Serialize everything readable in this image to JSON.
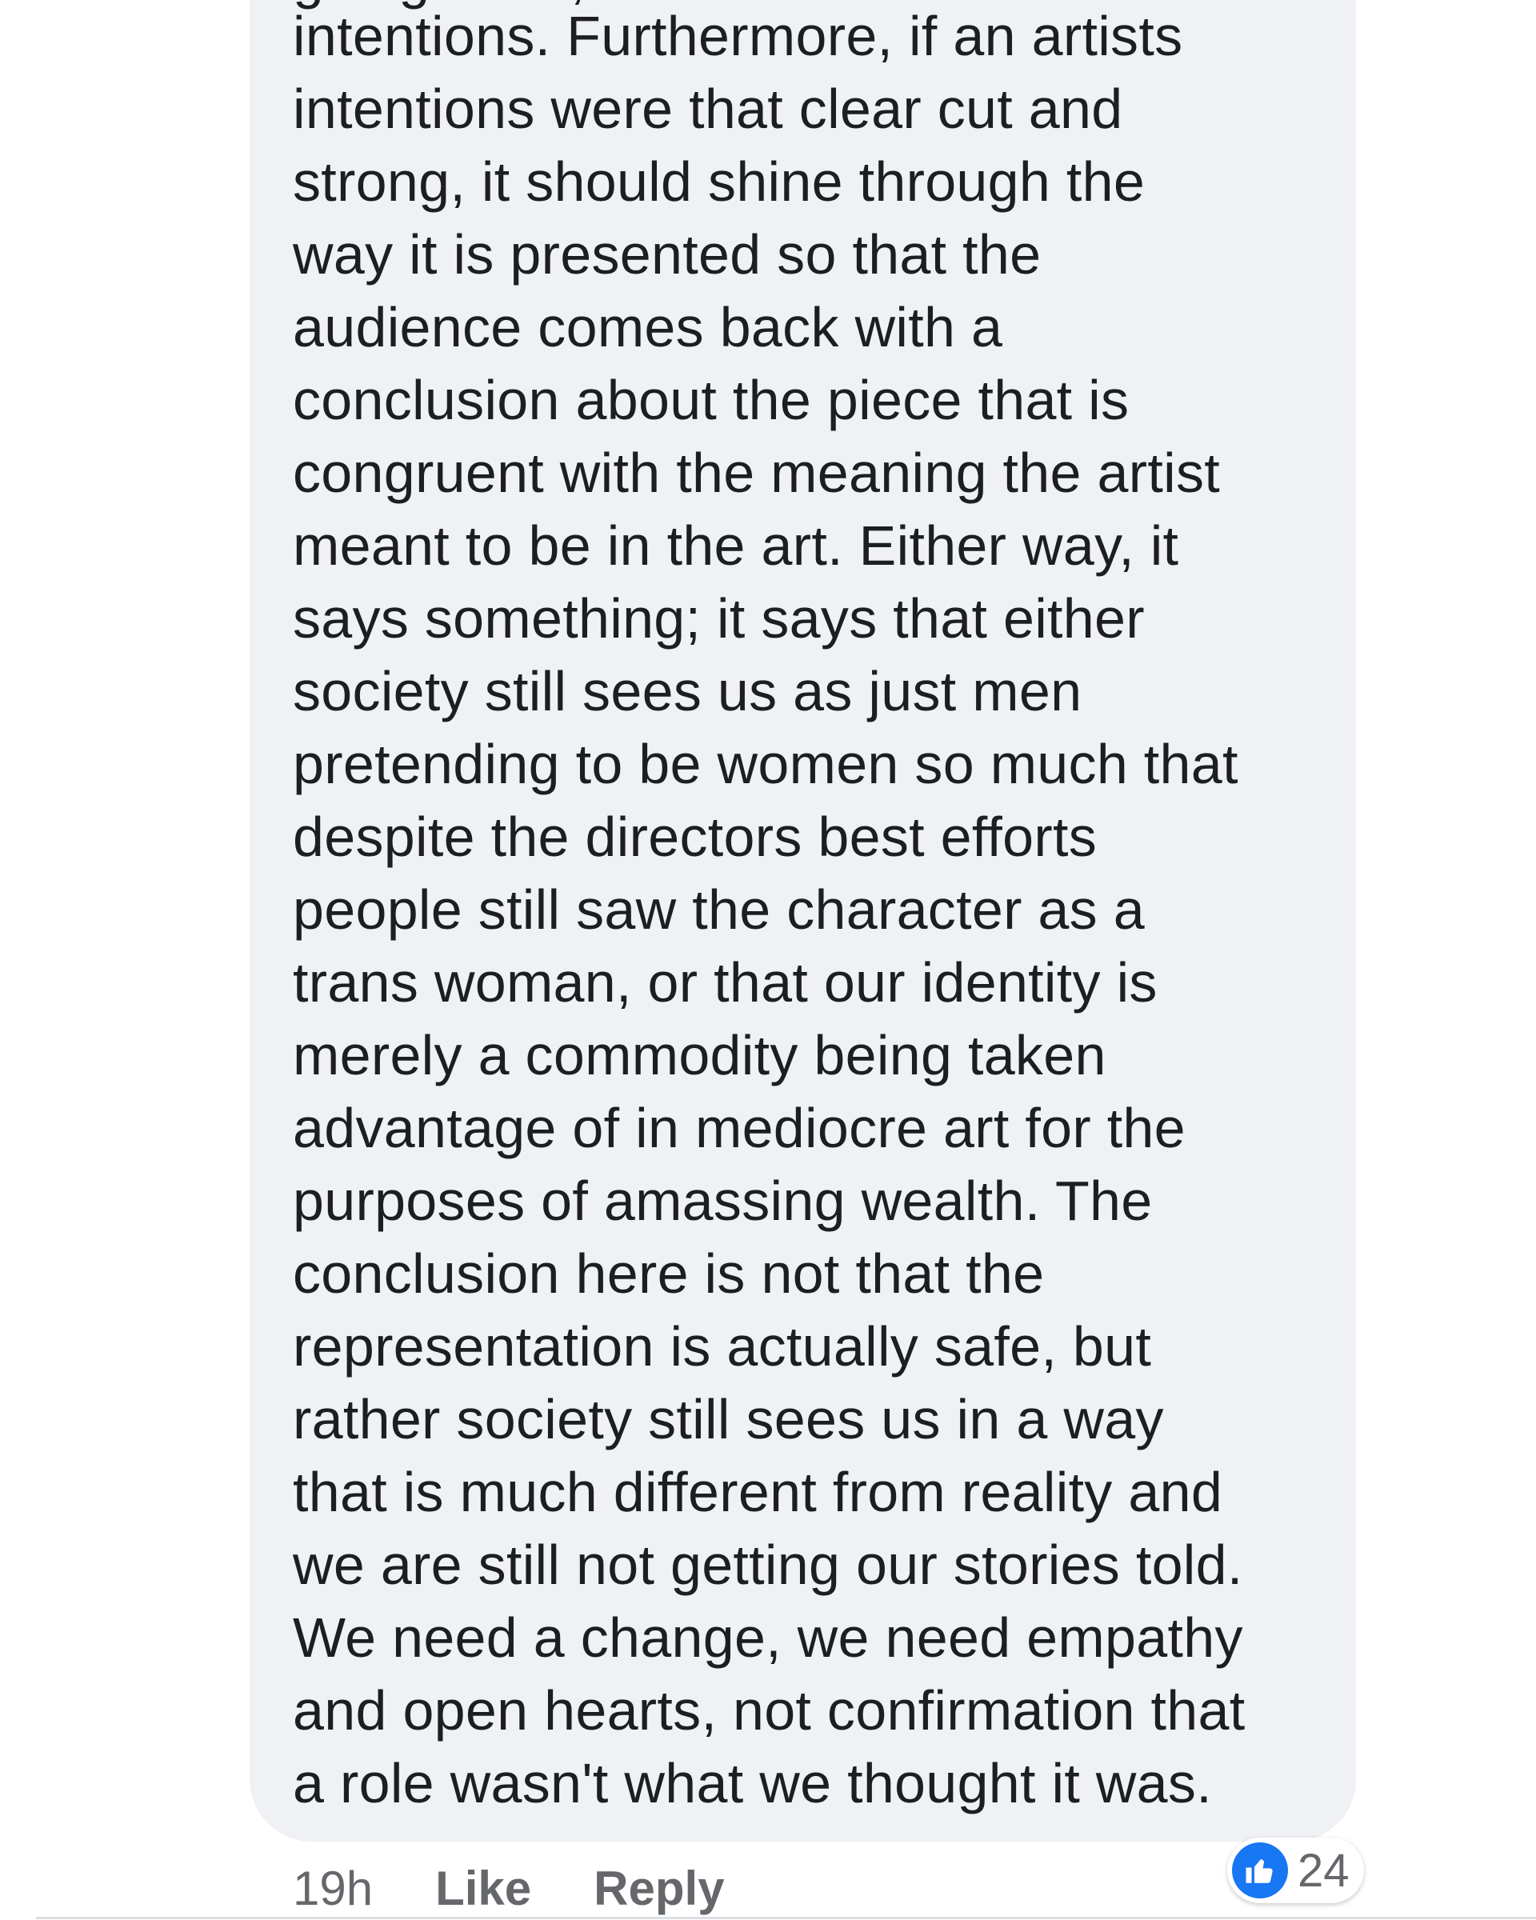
{
  "comment": {
    "cut_line": "going to be, and the director's",
    "lines": [
      "intentions. Furthermore, if an artists",
      "intentions were that clear cut and",
      "strong, it should shine through the",
      "way it is presented so that the",
      "audience comes back with a",
      "conclusion about the piece that is",
      "congruent with the meaning the artist",
      "meant to be in the art. Either way, it",
      "says something; it says that either",
      "society still sees us as just men",
      "pretending to be women so much that",
      "despite the directors best efforts",
      "people still saw the character as a",
      "trans woman, or that our identity is",
      "merely a commodity being taken",
      "advantage of in mediocre art for the",
      "purposes of amassing wealth. The",
      "conclusion here is not that the",
      "representation is actually safe, but",
      "rather society still sees us in a way",
      "that is much different from reality and",
      "we are still not getting our stories told.",
      "We need a change, we need empathy",
      "and open hearts, not confirmation that",
      "a role wasn't what we thought it was."
    ]
  },
  "actions": {
    "time": "19h",
    "like_label": "Like",
    "reply_label": "Reply"
  },
  "reactions": {
    "icon": "thumbs-up-icon",
    "count": "24",
    "badge_color": "#1877f2"
  },
  "colors": {
    "bubble": "#f0f1f4",
    "text": "#1c1e21",
    "meta": "#65676b"
  }
}
